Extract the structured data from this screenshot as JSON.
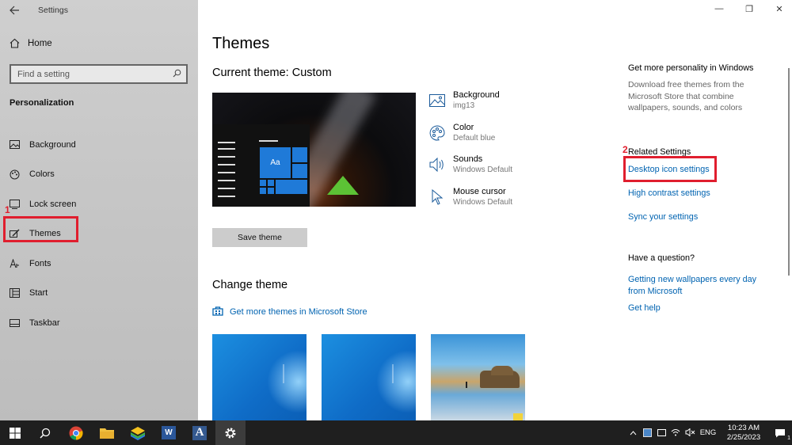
{
  "window": {
    "title": "Settings",
    "controls": {
      "minimize": "—",
      "restore": "❐",
      "close": "✕"
    }
  },
  "sidebar": {
    "home_label": "Home",
    "search_placeholder": "Find a setting",
    "section": "Personalization",
    "items": [
      {
        "label": "Background",
        "icon": "background-icon"
      },
      {
        "label": "Colors",
        "icon": "palette-icon"
      },
      {
        "label": "Lock screen",
        "icon": "lock-screen-icon"
      },
      {
        "label": "Themes",
        "icon": "themes-icon"
      },
      {
        "label": "Fonts",
        "icon": "fonts-icon"
      },
      {
        "label": "Start",
        "icon": "start-icon"
      },
      {
        "label": "Taskbar",
        "icon": "taskbar-icon"
      }
    ]
  },
  "annotations": {
    "step1": "1",
    "step2": "2",
    "color": "#e01e2e"
  },
  "main": {
    "title": "Themes",
    "current_theme": "Current theme: Custom",
    "attributes": [
      {
        "name": "Background",
        "value": "img13",
        "icon": "picture-icon"
      },
      {
        "name": "Color",
        "value": "Default blue",
        "icon": "palette-icon"
      },
      {
        "name": "Sounds",
        "value": "Windows Default",
        "icon": "speaker-icon"
      },
      {
        "name": "Mouse cursor",
        "value": "Windows Default",
        "icon": "cursor-icon"
      }
    ],
    "preview_tile_label": "Aa",
    "save_button": "Save theme",
    "change_theme": "Change theme",
    "store_link": "Get more themes in Microsoft Store"
  },
  "right": {
    "personality_head": "Get more personality in Windows",
    "personality_desc": "Download free themes from the Microsoft Store that combine wallpapers, sounds, and colors",
    "related_head": "Related Settings",
    "links": [
      "Desktop icon settings",
      "High contrast settings",
      "Sync your settings"
    ],
    "question_head": "Have a question?",
    "help_links": [
      "Getting new wallpapers every day from Microsoft",
      "Get help"
    ]
  },
  "taskbar": {
    "language": "ENG",
    "time": "10:23 AM",
    "date": "2/25/2023",
    "notification_count": "1",
    "word_letter": "W",
    "font_app_letter": "A"
  },
  "colors": {
    "accent": "#0063b1",
    "sidebar_bg": "#c7c7c7",
    "taskbar_bg": "#1f1f1f",
    "tile_blue": "#1f7ad8"
  }
}
